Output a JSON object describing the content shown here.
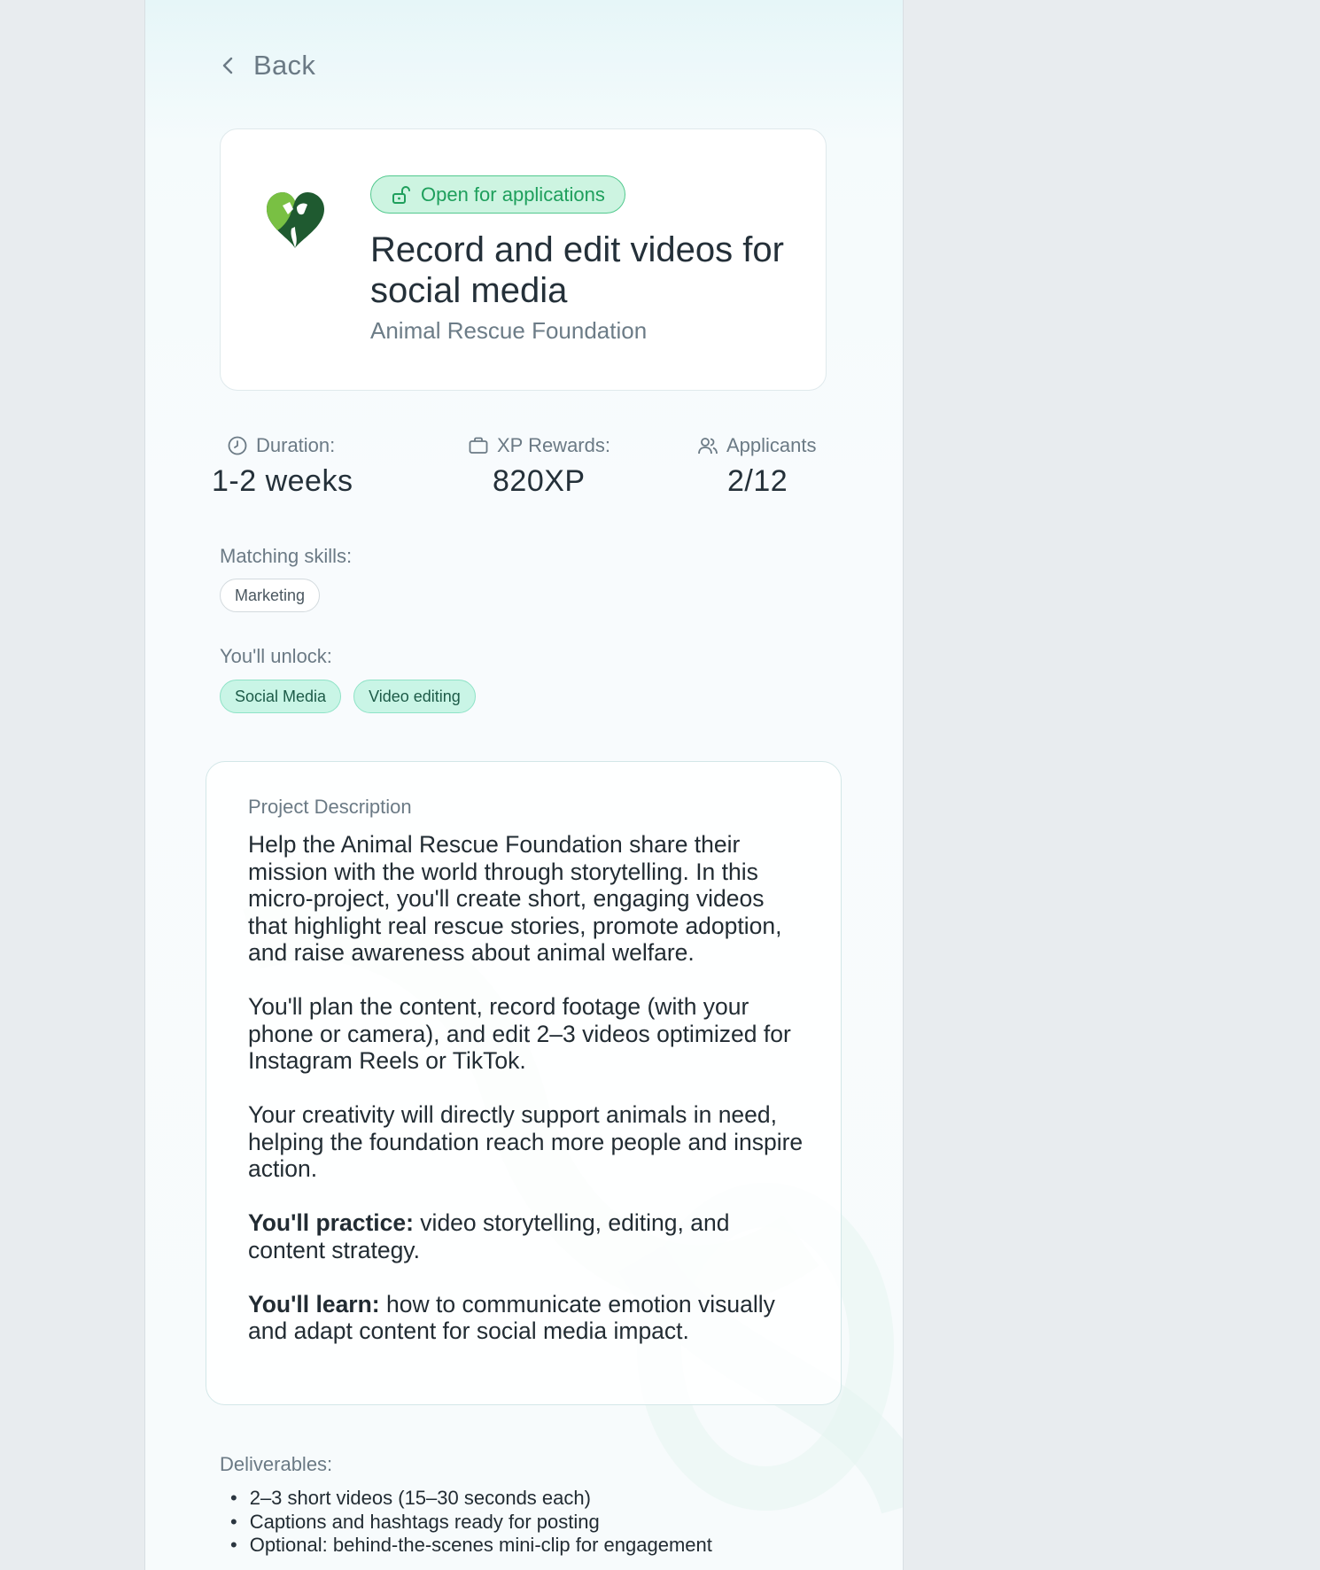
{
  "nav": {
    "back_label": "Back"
  },
  "project": {
    "status_badge": "Open for applications",
    "title": "Record and edit videos for social media",
    "organization": "Animal Rescue Foundation",
    "logo_icon": "heart-paw-logo",
    "accent": "#1e9f5c"
  },
  "stats": {
    "duration": {
      "label": "Duration:",
      "value": "1-2 weeks",
      "icon": "clock-icon"
    },
    "xp": {
      "label": "XP Rewards:",
      "value": "820XP",
      "icon": "briefcase-icon"
    },
    "applicants": {
      "label": "Applicants",
      "value": "2/12",
      "icon": "users-icon"
    }
  },
  "skills": {
    "matching_label": "Matching skills:",
    "matching": [
      "Marketing"
    ],
    "unlock_label": "You'll unlock:",
    "unlock": [
      "Social Media",
      "Video editing"
    ]
  },
  "description": {
    "title": "Project Description",
    "paragraphs": [
      "Help the Animal Rescue Foundation share their mission with the world through storytelling. In this micro-project, you'll create short, engaging videos that highlight real rescue stories, promote adoption, and raise awareness about animal welfare.",
      "You'll plan the content, record footage (with your phone or camera), and edit 2–3 videos optimized for Instagram Reels or TikTok.",
      "Your creativity will directly support animals in need, helping the foundation reach more people and inspire action."
    ],
    "practice_label": "You'll practice:",
    "practice_text": " video storytelling, editing, and content strategy.",
    "learn_label": "You'll learn:",
    "learn_text": " how to communicate emotion visually and adapt content for social media impact."
  },
  "deliverables": {
    "label": "Deliverables:",
    "items": [
      "2–3 short videos (15–30 seconds each)",
      "Captions and hashtags ready for posting",
      "Optional: behind-the-scenes mini-clip for engagement"
    ]
  }
}
